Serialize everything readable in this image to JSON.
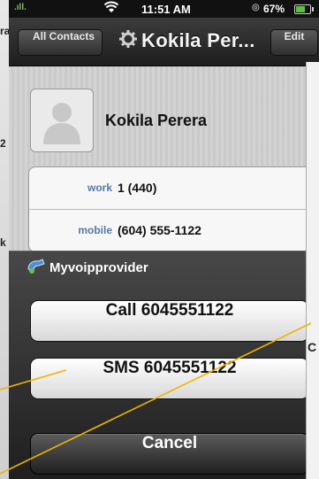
{
  "background": {
    "left_fragments": [
      "ra",
      "2",
      "k"
    ],
    "right_fragment": "C"
  },
  "status_bar": {
    "carrier_icon": "signal-bars-icon",
    "wifi_icon": "wifi-icon",
    "time": "11:51 AM",
    "alarm_icon": "alarm-icon",
    "battery_percent": "67%",
    "battery_icon": "battery-icon"
  },
  "nav": {
    "back_label": "All Contacts",
    "title_icon": "gear-icon",
    "title": "Kokila Per...",
    "edit_label": "Edit"
  },
  "contact": {
    "avatar_icon": "person-silhouette-icon",
    "name": "Kokila Perera",
    "phones": [
      {
        "label": "work",
        "value": "1 (440)"
      },
      {
        "label": "mobile",
        "value": "(604) 555-1122"
      }
    ]
  },
  "action_sheet": {
    "provider_icon": "voip-phone-icon",
    "provider_name": "Myvoipprovider",
    "call_label": "Call 6045551122",
    "sms_label": "SMS 6045551122",
    "cancel_label": "Cancel"
  },
  "colors": {
    "accent_label": "#5878a6",
    "callout_line": "#f0b400",
    "battery_fill": "#5fbf3f"
  }
}
